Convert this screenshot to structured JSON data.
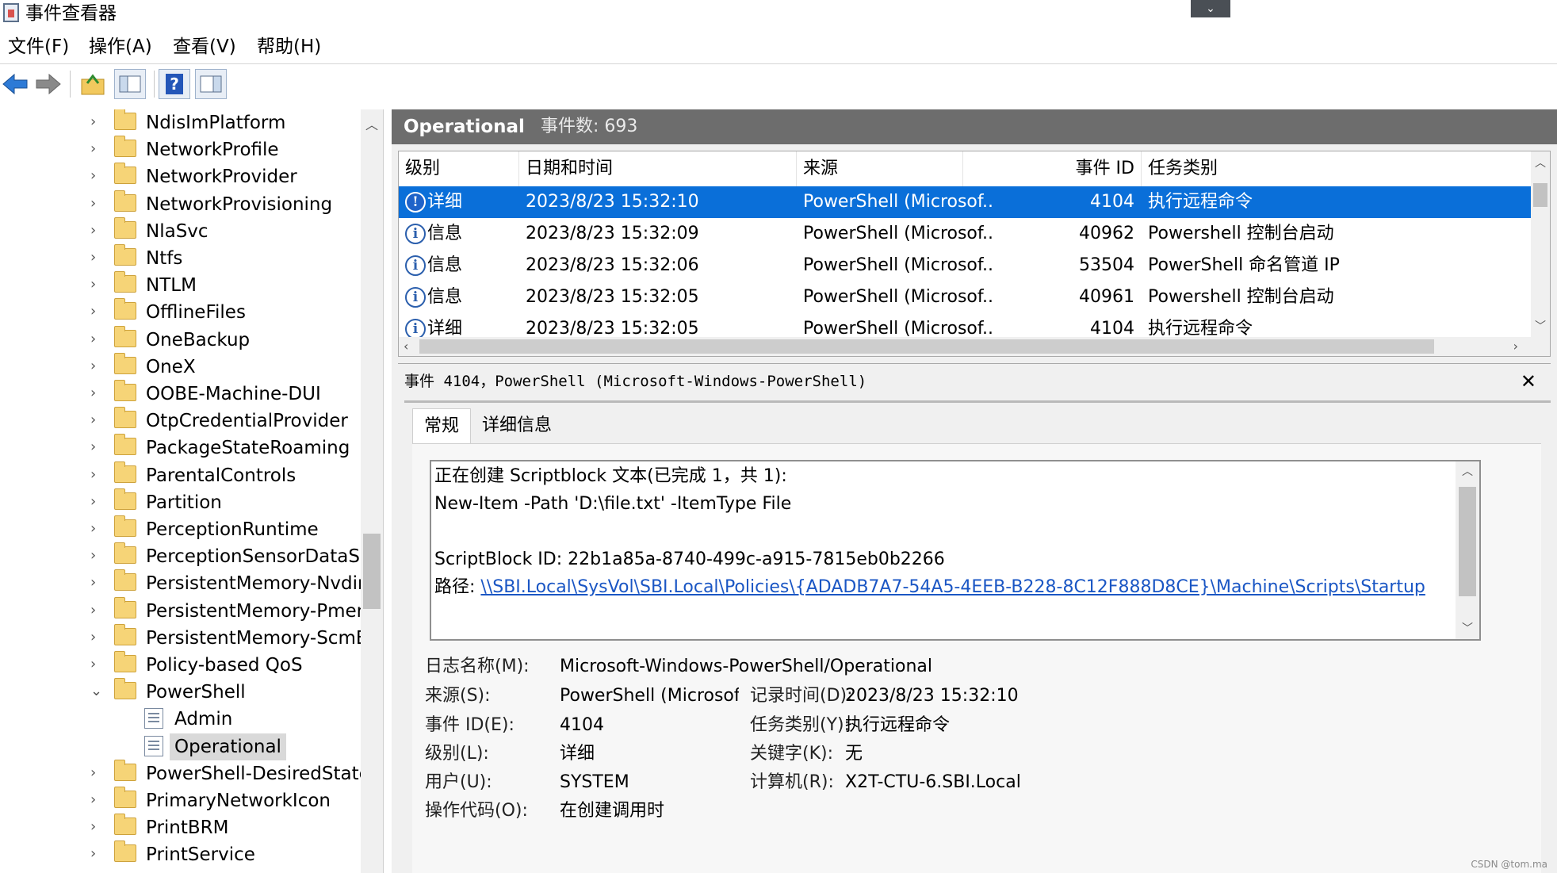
{
  "window": {
    "title": "事件查看器"
  },
  "menu": [
    "文件(F)",
    "操作(A)",
    "查看(V)",
    "帮助(H)"
  ],
  "toolbar": [
    "back-arrow",
    "forward-arrow",
    "folder-up",
    "console-tree",
    "help",
    "action-pane"
  ],
  "tree": {
    "items": [
      "NdisImPlatform",
      "NetworkProfile",
      "NetworkProvider",
      "NetworkProvisioning",
      "NlaSvc",
      "Ntfs",
      "NTLM",
      "OfflineFiles",
      "OneBackup",
      "OneX",
      "OOBE-Machine-DUI",
      "OtpCredentialProvider",
      "PackageStateRoaming",
      "ParentalControls",
      "Partition",
      "PerceptionRuntime",
      "PerceptionSensorDataSer",
      "PersistentMemory-Nvdim",
      "PersistentMemory-Pmem",
      "PersistentMemory-ScmBu",
      "Policy-based QoS",
      "PowerShell"
    ],
    "children": [
      "Admin",
      "Operational"
    ],
    "after": [
      "PowerShell-DesiredStateC",
      "PrimaryNetworkIcon",
      "PrintBRM",
      "PrintService"
    ]
  },
  "log_header": {
    "name": "Operational",
    "count_text": "事件数: 693"
  },
  "event_columns": [
    "级别",
    "日期和时间",
    "来源",
    "事件 ID",
    "任务类别"
  ],
  "events": [
    {
      "level": "详细",
      "datetime": "2023/8/23 15:32:10",
      "source": "PowerShell (Microsof...",
      "id": "4104",
      "task": "执行远程命令"
    },
    {
      "level": "信息",
      "datetime": "2023/8/23 15:32:09",
      "source": "PowerShell (Microsof...",
      "id": "40962",
      "task": "Powershell 控制台启动"
    },
    {
      "level": "信息",
      "datetime": "2023/8/23 15:32:06",
      "source": "PowerShell (Microsof...",
      "id": "53504",
      "task": "PowerShell 命名管道 IP"
    },
    {
      "level": "信息",
      "datetime": "2023/8/23 15:32:05",
      "source": "PowerShell (Microsof...",
      "id": "40961",
      "task": "Powershell 控制台启动"
    },
    {
      "level": "详细",
      "datetime": "2023/8/23 15:32:05",
      "source": "PowerShell (Microsof...",
      "id": "4104",
      "task": "执行远程命令"
    }
  ],
  "detail": {
    "title": "事件 4104，PowerShell (Microsoft-Windows-PowerShell)",
    "tabs": [
      "常规",
      "详细信息"
    ],
    "description": {
      "line1": "正在创建 Scriptblock 文本(已完成 1，共 1):",
      "line2": "New-Item -Path 'D:\\file.txt' -ItemType File",
      "line3": "ScriptBlock ID: 22b1a85a-8740-499c-a915-7815eb0b2266",
      "path_label": "路径: ",
      "path_link": "\\\\SBI.Local\\SysVol\\SBI.Local\\Policies\\{ADADB7A7-54A5-4EEB-B228-8C12F888D8CE}\\Machine\\Scripts\\Startup"
    },
    "props": {
      "log_name_label": "日志名称(M):",
      "log_name": "Microsoft-Windows-PowerShell/Operational",
      "source_label": "来源(S):",
      "source": "PowerShell (Microsoft-Winc",
      "logged_label": "记录时间(D):",
      "logged": "2023/8/23 15:32:10",
      "event_id_label": "事件 ID(E):",
      "event_id": "4104",
      "task_label": "任务类别(Y):",
      "task": "执行远程命令",
      "level_label": "级别(L):",
      "level": "详细",
      "keywords_label": "关键字(K):",
      "keywords": "无",
      "user_label": "用户(U):",
      "user": "SYSTEM",
      "computer_label": "计算机(R):",
      "computer": "X2T-CTU-6.SBI.Local",
      "opcode_label": "操作代码(O):",
      "opcode": "在创建调用时"
    }
  },
  "watermark": "CSDN @tom.ma"
}
